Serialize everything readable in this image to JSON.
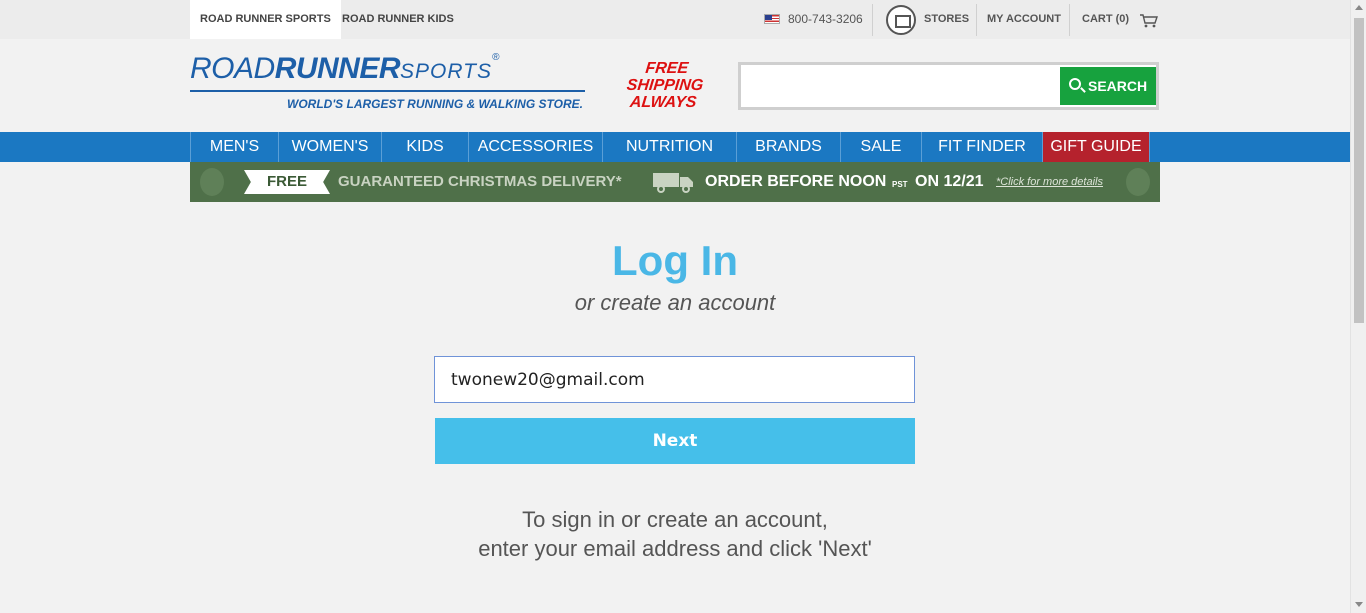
{
  "topbar": {
    "site_tabs": [
      "ROAD RUNNER SPORTS",
      "ROAD RUNNER KIDS"
    ],
    "phone": "800-743-3206",
    "stores": "STORES",
    "account": "MY ACCOUNT",
    "cart": "CART (0)"
  },
  "header": {
    "logo_road": "ROAD",
    "logo_runner": "RUNNER",
    "logo_sports": "SPORTS",
    "logo_mark": "®",
    "tagline": "WORLD'S LARGEST RUNNING & WALKING STORE.",
    "free_shipping": [
      "FREE",
      "SHIPPING",
      "ALWAYS"
    ],
    "search_placeholder": "",
    "search_button": "SEARCH"
  },
  "nav": {
    "items": [
      "MEN'S",
      "WOMEN'S",
      "KIDS",
      "ACCESSORIES",
      "NUTRITION",
      "BRANDS",
      "SALE",
      "FIT FINDER",
      "GIFT GUIDE"
    ]
  },
  "promo": {
    "free": "FREE",
    "guaranteed": "GUARANTEED CHRISTMAS DELIVERY*",
    "order_before": "ORDER BEFORE NOON",
    "pst": "PST",
    "date": "ON 12/21",
    "details": "*Click for more details"
  },
  "login": {
    "title": "Log In",
    "subtitle": "or create an account",
    "email_value": "twonew20@gmail.com",
    "next_button": "Next",
    "help_line1": "To sign in or create an account,",
    "help_line2": "enter your email address and click 'Next'"
  },
  "colors": {
    "brand_blue": "#1d5fa8",
    "nav_blue": "#1b78c2",
    "gift_red": "#b5222d",
    "search_green": "#17a23e",
    "promo_green": "#4f7049",
    "title_blue": "#4ab7e6",
    "next_blue": "#45bfea"
  },
  "icons": [
    "us-flag-icon",
    "store-icon",
    "cart-icon",
    "search-icon",
    "truck-icon",
    "ornament-icon"
  ]
}
